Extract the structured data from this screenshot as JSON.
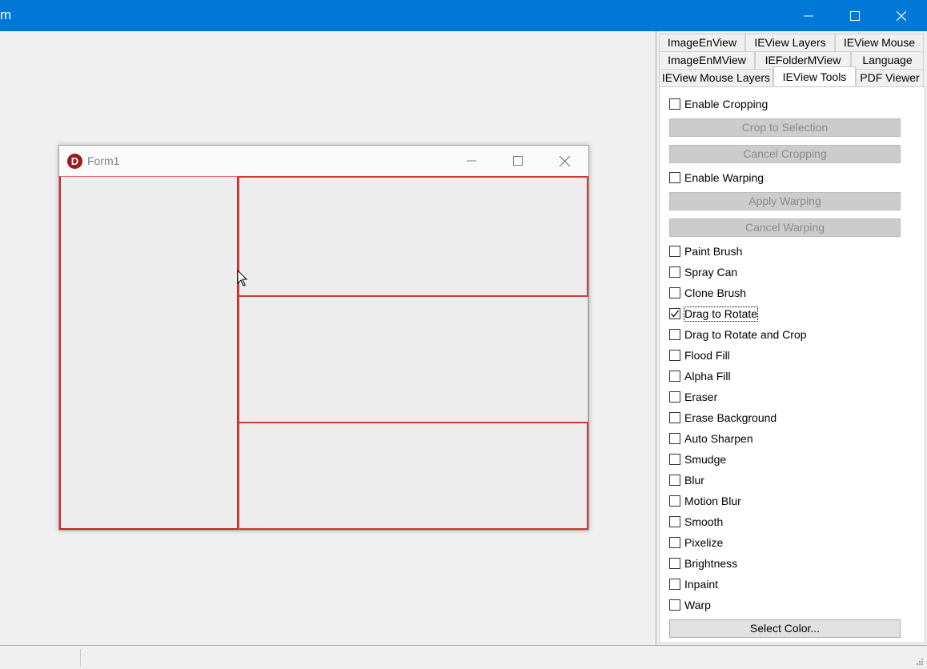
{
  "app": {
    "title": "m"
  },
  "form1": {
    "title": "Form1",
    "logo_letter": "D"
  },
  "tabs": {
    "row1": [
      {
        "label": "ImageEnView"
      },
      {
        "label": "IEView Layers"
      },
      {
        "label": "IEView Mouse"
      }
    ],
    "row2": [
      {
        "label": "ImageEnMView"
      },
      {
        "label": "IEFolderMView"
      },
      {
        "label": "Language"
      }
    ],
    "row3": [
      {
        "label": "IEView Mouse Layers"
      },
      {
        "label": "IEView Tools"
      },
      {
        "label": "PDF Viewer"
      }
    ],
    "active": "IEView Tools"
  },
  "tools": {
    "enable_cropping": {
      "label": "Enable Cropping",
      "checked": false
    },
    "crop_to_selection": "Crop to Selection",
    "cancel_cropping": "Cancel Cropping",
    "enable_warping": {
      "label": "Enable Warping",
      "checked": false
    },
    "apply_warping": "Apply Warping",
    "cancel_warping": "Cancel Warping",
    "items": [
      {
        "label": "Paint Brush",
        "checked": false
      },
      {
        "label": "Spray Can",
        "checked": false
      },
      {
        "label": "Clone Brush",
        "checked": false
      },
      {
        "label": "Drag to Rotate",
        "checked": true
      },
      {
        "label": "Drag to Rotate and Crop",
        "checked": false
      },
      {
        "label": "Flood Fill",
        "checked": false
      },
      {
        "label": "Alpha Fill",
        "checked": false
      },
      {
        "label": "Eraser",
        "checked": false
      },
      {
        "label": "Erase Background",
        "checked": false
      },
      {
        "label": "Auto Sharpen",
        "checked": false
      },
      {
        "label": "Smudge",
        "checked": false
      },
      {
        "label": "Blur",
        "checked": false
      },
      {
        "label": "Motion Blur",
        "checked": false
      },
      {
        "label": "Smooth",
        "checked": false
      },
      {
        "label": "Pixelize",
        "checked": false
      },
      {
        "label": "Brightness",
        "checked": false
      },
      {
        "label": "Inpaint",
        "checked": false
      },
      {
        "label": "Warp",
        "checked": false
      }
    ],
    "select_color": "Select Color..."
  },
  "colors": {
    "titlebar": "#0078d7",
    "panel_border": "#d23a3a",
    "disabled_button": "#cccccc"
  }
}
